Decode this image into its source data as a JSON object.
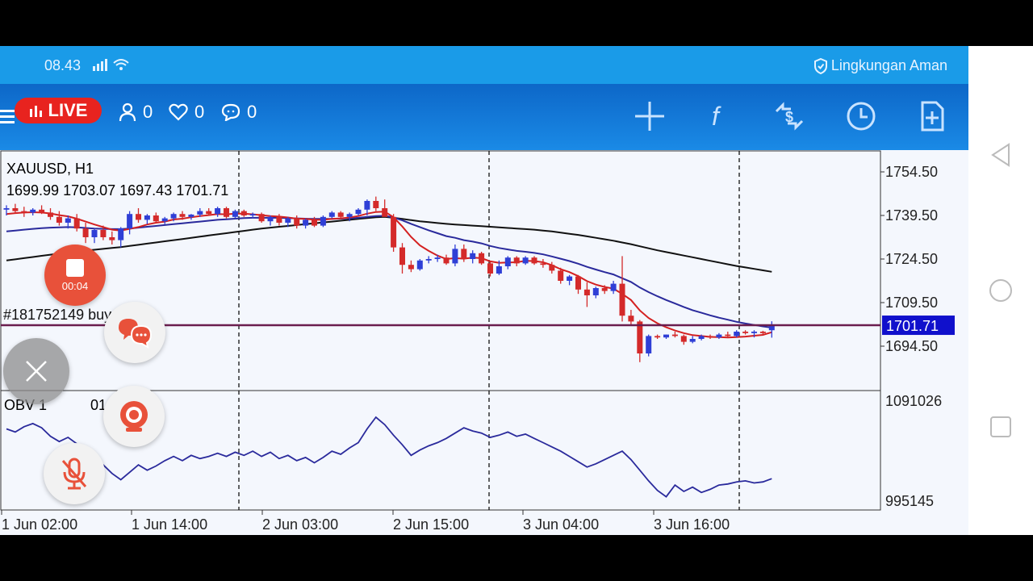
{
  "status_bar": {
    "time": "08.43",
    "security_text": "Lingkungan Aman"
  },
  "live": {
    "label": "LIVE",
    "viewers": "0",
    "likes": "0",
    "comments": "0",
    "record_timer": "00:04"
  },
  "toolbar": {
    "icons": [
      "crosshair-icon",
      "function-icon",
      "trade-icon",
      "clock-icon",
      "new-order-icon"
    ]
  },
  "chart_header": {
    "symbol": "XAUUSD, H1",
    "ohlc": "1699.99 1703.07 1697.43 1701.71",
    "position_line": "#181752149 buy, 0.05"
  },
  "indicator": {
    "label": "OBV 1?...01",
    "label_visible": "OBV 1",
    "label_tail": "01",
    "axis_high": "1091026",
    "axis_low": "995145"
  },
  "colors": {
    "bull": "#2f3fd6",
    "bear": "#d42a2a",
    "ma_fast": "#d42020",
    "ma_mid": "#2a2a9c",
    "ma_slow": "#111111",
    "price_tag": "#1010cc",
    "position_line": "#6a1d4e"
  },
  "chart_data": {
    "type": "candlestick",
    "price_axis_ticks": [
      "1754.50",
      "1739.50",
      "1724.50",
      "1709.50",
      "1694.50"
    ],
    "price_axis_values": [
      1754.5,
      1739.5,
      1724.5,
      1709.5,
      1694.5
    ],
    "current_price": "1701.71",
    "current_price_value": 1701.71,
    "time_axis_labels": [
      "1 Jun 02:00",
      "1 Jun 14:00",
      "2 Jun 03:00",
      "2 Jun 15:00",
      "3 Jun 04:00",
      "3 Jun 16:00"
    ],
    "candles": [
      [
        1741.5,
        1743.0,
        1739.5,
        1742.0
      ],
      [
        1742.0,
        1743.5,
        1740.5,
        1741.0
      ],
      [
        1741.0,
        1742.5,
        1739.0,
        1740.5
      ],
      [
        1740.5,
        1742.0,
        1739.5,
        1741.5
      ],
      [
        1741.5,
        1743.0,
        1740.0,
        1740.5
      ],
      [
        1740.5,
        1742.0,
        1738.0,
        1739.0
      ],
      [
        1739.0,
        1741.0,
        1736.0,
        1737.0
      ],
      [
        1737.0,
        1739.5,
        1735.0,
        1738.5
      ],
      [
        1738.5,
        1740.0,
        1734.0,
        1735.0
      ],
      [
        1735.0,
        1737.0,
        1730.0,
        1732.0
      ],
      [
        1732.0,
        1735.0,
        1730.0,
        1734.5
      ],
      [
        1734.5,
        1736.0,
        1731.0,
        1732.0
      ],
      [
        1732.0,
        1734.0,
        1729.5,
        1731.0
      ],
      [
        1731.0,
        1735.5,
        1728.5,
        1735.0
      ],
      [
        1735.0,
        1741.0,
        1733.0,
        1740.0
      ],
      [
        1740.0,
        1742.0,
        1737.0,
        1738.0
      ],
      [
        1738.0,
        1740.0,
        1736.5,
        1739.5
      ],
      [
        1739.5,
        1740.5,
        1737.0,
        1737.5
      ],
      [
        1737.5,
        1739.0,
        1736.5,
        1738.5
      ],
      [
        1738.5,
        1740.5,
        1737.5,
        1740.0
      ],
      [
        1740.0,
        1741.0,
        1738.0,
        1739.0
      ],
      [
        1739.0,
        1740.0,
        1738.0,
        1739.8
      ],
      [
        1739.8,
        1742.0,
        1739.0,
        1741.0
      ],
      [
        1741.0,
        1742.0,
        1739.5,
        1740.0
      ],
      [
        1740.0,
        1742.5,
        1739.0,
        1742.0
      ],
      [
        1742.0,
        1742.5,
        1738.5,
        1739.0
      ],
      [
        1739.0,
        1741.5,
        1738.5,
        1741.0
      ],
      [
        1741.0,
        1741.5,
        1739.0,
        1739.5
      ],
      [
        1739.5,
        1740.5,
        1738.5,
        1740.0
      ],
      [
        1740.0,
        1740.5,
        1737.0,
        1737.5
      ],
      [
        1737.5,
        1739.5,
        1736.0,
        1739.0
      ],
      [
        1739.0,
        1740.0,
        1736.0,
        1737.0
      ],
      [
        1737.0,
        1739.0,
        1735.5,
        1738.5
      ],
      [
        1738.5,
        1739.5,
        1735.0,
        1736.0
      ],
      [
        1736.0,
        1738.5,
        1735.0,
        1738.0
      ],
      [
        1738.0,
        1739.0,
        1735.5,
        1736.0
      ],
      [
        1736.0,
        1739.5,
        1735.5,
        1739.0
      ],
      [
        1739.0,
        1741.0,
        1738.5,
        1740.5
      ],
      [
        1740.5,
        1741.0,
        1738.5,
        1739.0
      ],
      [
        1739.0,
        1740.5,
        1737.5,
        1740.0
      ],
      [
        1740.0,
        1742.0,
        1739.5,
        1741.5
      ],
      [
        1741.5,
        1745.0,
        1739.5,
        1744.5
      ],
      [
        1744.5,
        1746.0,
        1741.0,
        1742.0
      ],
      [
        1742.0,
        1745.0,
        1740.0,
        1739.0
      ],
      [
        1739.0,
        1740.0,
        1727.0,
        1728.5
      ],
      [
        1728.5,
        1730.0,
        1719.5,
        1722.5
      ],
      [
        1722.5,
        1724.0,
        1720.0,
        1721.0
      ],
      [
        1721.0,
        1724.5,
        1720.5,
        1724.0
      ],
      [
        1724.0,
        1725.5,
        1723.0,
        1724.5
      ],
      [
        1724.5,
        1726.0,
        1723.5,
        1725.0
      ],
      [
        1725.0,
        1726.0,
        1722.5,
        1723.0
      ],
      [
        1723.0,
        1729.5,
        1722.0,
        1728.0
      ],
      [
        1728.0,
        1729.5,
        1723.5,
        1724.5
      ],
      [
        1724.5,
        1727.5,
        1723.0,
        1726.5
      ],
      [
        1726.5,
        1727.0,
        1722.5,
        1723.0
      ],
      [
        1723.0,
        1723.5,
        1718.5,
        1719.5
      ],
      [
        1719.5,
        1724.0,
        1719.0,
        1722.0
      ],
      [
        1722.0,
        1725.5,
        1721.0,
        1725.0
      ],
      [
        1725.0,
        1725.5,
        1722.0,
        1723.0
      ],
      [
        1723.0,
        1725.5,
        1722.5,
        1725.0
      ],
      [
        1725.0,
        1725.5,
        1722.5,
        1723.0
      ],
      [
        1723.0,
        1724.5,
        1721.5,
        1722.5
      ],
      [
        1722.5,
        1723.5,
        1719.5,
        1720.5
      ],
      [
        1720.5,
        1721.5,
        1716.0,
        1717.0
      ],
      [
        1717.0,
        1719.0,
        1715.5,
        1718.5
      ],
      [
        1718.5,
        1719.0,
        1712.5,
        1714.0
      ],
      [
        1714.0,
        1716.5,
        1708.0,
        1712.0
      ],
      [
        1712.0,
        1715.0,
        1711.0,
        1714.5
      ],
      [
        1714.5,
        1715.5,
        1712.5,
        1713.5
      ],
      [
        1713.5,
        1717.0,
        1712.5,
        1716.0
      ],
      [
        1716.0,
        1725.5,
        1703.0,
        1705.0
      ],
      [
        1705.0,
        1707.0,
        1701.5,
        1703.0
      ],
      [
        1703.0,
        1703.5,
        1689.0,
        1692.0
      ],
      [
        1692.0,
        1698.5,
        1691.0,
        1698.0
      ],
      [
        1698.0,
        1698.5,
        1697.0,
        1697.5
      ],
      [
        1697.5,
        1698.5,
        1697.0,
        1698.5
      ],
      [
        1698.5,
        1699.5,
        1697.5,
        1698.0
      ],
      [
        1698.0,
        1698.5,
        1695.0,
        1696.0
      ],
      [
        1696.0,
        1698.0,
        1695.5,
        1697.0
      ],
      [
        1697.0,
        1698.5,
        1696.5,
        1698.0
      ],
      [
        1698.0,
        1698.5,
        1697.0,
        1697.5
      ],
      [
        1697.5,
        1699.0,
        1697.0,
        1698.5
      ],
      [
        1698.5,
        1699.5,
        1697.5,
        1698.0
      ],
      [
        1698.0,
        1700.0,
        1697.5,
        1699.5
      ],
      [
        1699.5,
        1700.0,
        1698.5,
        1699.0
      ],
      [
        1699.0,
        1700.0,
        1697.5,
        1699.5
      ],
      [
        1699.5,
        1699.8,
        1698.5,
        1699.0
      ],
      [
        1699.99,
        1703.07,
        1697.43,
        1701.71
      ]
    ],
    "ma_fast": [
      1740,
      1740.3,
      1740.5,
      1740.6,
      1740.5,
      1740.2,
      1739.6,
      1739.2,
      1738.4,
      1737.4,
      1736.4,
      1735.5,
      1734.6,
      1734.3,
      1734.9,
      1735.5,
      1736.4,
      1737.0,
      1737.4,
      1738.1,
      1738.4,
      1738.9,
      1739.3,
      1739.6,
      1740.0,
      1739.9,
      1740.1,
      1740.1,
      1739.9,
      1739.6,
      1739.3,
      1739.1,
      1738.8,
      1738.4,
      1738.3,
      1738.0,
      1738.0,
      1738.3,
      1738.5,
      1738.8,
      1739.3,
      1740.1,
      1740.7,
      1740.8,
      1738.9,
      1735.7,
      1732.1,
      1729.2,
      1727.3,
      1725.7,
      1724.5,
      1724.8,
      1724.6,
      1725.0,
      1724.8,
      1723.7,
      1723.2,
      1723.3,
      1723.4,
      1723.9,
      1723.8,
      1723.4,
      1722.4,
      1721.0,
      1720.0,
      1718.6,
      1716.9,
      1715.7,
      1714.9,
      1714.3,
      1712.5,
      1710.4,
      1706.8,
      1704.2,
      1702.4,
      1701.0,
      1699.9,
      1699.0,
      1698.3,
      1698.0,
      1697.7,
      1697.6,
      1697.5,
      1697.6,
      1697.8,
      1698.1,
      1698.4,
      1699.3
    ],
    "ma_mid": [
      1734,
      1734.3,
      1734.6,
      1734.9,
      1735.1,
      1735.3,
      1735.4,
      1735.5,
      1735.4,
      1735.2,
      1735.0,
      1734.9,
      1734.8,
      1734.8,
      1735.0,
      1735.3,
      1735.6,
      1735.9,
      1736.2,
      1736.5,
      1736.8,
      1737.1,
      1737.4,
      1737.7,
      1738.0,
      1738.2,
      1738.4,
      1738.6,
      1738.7,
      1738.7,
      1738.7,
      1738.7,
      1738.6,
      1738.5,
      1738.4,
      1738.3,
      1738.3,
      1738.3,
      1738.4,
      1738.5,
      1738.7,
      1739.0,
      1739.3,
      1739.4,
      1738.8,
      1737.8,
      1736.6,
      1735.5,
      1734.4,
      1733.4,
      1732.4,
      1731.8,
      1731.0,
      1730.5,
      1729.9,
      1729.0,
      1728.3,
      1727.8,
      1727.3,
      1727.0,
      1726.6,
      1726.1,
      1725.4,
      1724.6,
      1723.8,
      1722.9,
      1721.8,
      1720.9,
      1720.0,
      1719.2,
      1717.9,
      1716.6,
      1714.7,
      1713.1,
      1711.7,
      1710.4,
      1709.2,
      1708.0,
      1706.9,
      1706.0,
      1705.1,
      1704.3,
      1703.6,
      1702.9,
      1702.3,
      1701.8,
      1701.3,
      1700.9
    ],
    "ma_slow": [
      1724,
      1724.4,
      1724.8,
      1725.2,
      1725.6,
      1726.0,
      1726.4,
      1726.8,
      1727.1,
      1727.4,
      1727.7,
      1728.0,
      1728.3,
      1728.6,
      1729.0,
      1729.4,
      1729.8,
      1730.2,
      1730.6,
      1731.0,
      1731.4,
      1731.8,
      1732.2,
      1732.6,
      1733.0,
      1733.4,
      1733.8,
      1734.2,
      1734.6,
      1735.0,
      1735.3,
      1735.6,
      1735.9,
      1736.2,
      1736.5,
      1736.8,
      1737.1,
      1737.4,
      1737.7,
      1738.0,
      1738.3,
      1738.6,
      1738.9,
      1739.0,
      1738.7,
      1738.3,
      1737.9,
      1737.5,
      1737.2,
      1736.9,
      1736.6,
      1736.4,
      1736.2,
      1736.0,
      1735.8,
      1735.6,
      1735.4,
      1735.2,
      1735.0,
      1734.8,
      1734.6,
      1734.3,
      1734.0,
      1733.6,
      1733.2,
      1732.8,
      1732.3,
      1731.8,
      1731.3,
      1730.8,
      1730.2,
      1729.6,
      1728.9,
      1728.2,
      1727.5,
      1726.9,
      1726.3,
      1725.7,
      1725.1,
      1724.5,
      1723.9,
      1723.3,
      1722.7,
      1722.1,
      1721.6,
      1721.1,
      1720.6,
      1720.1
    ],
    "obv": [
      1061000,
      1058000,
      1063000,
      1066000,
      1062000,
      1054000,
      1049000,
      1053000,
      1047000,
      1040000,
      1033000,
      1027000,
      1019000,
      1013000,
      1020000,
      1027000,
      1022000,
      1026000,
      1031000,
      1035000,
      1031000,
      1036000,
      1033000,
      1035000,
      1038000,
      1035000,
      1039000,
      1036000,
      1040000,
      1035000,
      1039000,
      1033000,
      1036000,
      1031000,
      1034000,
      1029000,
      1034000,
      1040000,
      1037000,
      1043000,
      1048000,
      1061000,
      1072000,
      1065000,
      1055000,
      1046000,
      1036000,
      1041000,
      1045000,
      1048000,
      1052000,
      1057000,
      1062000,
      1059000,
      1057000,
      1053000,
      1055000,
      1058000,
      1054000,
      1056000,
      1052000,
      1048000,
      1044000,
      1040000,
      1035000,
      1030000,
      1025000,
      1028000,
      1032000,
      1036000,
      1040000,
      1032000,
      1022000,
      1012000,
      1003000,
      997000,
      1008000,
      1002000,
      1006000,
      1001000,
      1004000,
      1008000,
      1009000,
      1011000,
      1012000,
      1010000,
      1011000,
      1014000
    ],
    "obv_range": [
      995145,
      1091026
    ],
    "separators": [
      "1 Jun 20:00",
      "2 Jun 21:00",
      "3 Jun 22:00"
    ]
  }
}
